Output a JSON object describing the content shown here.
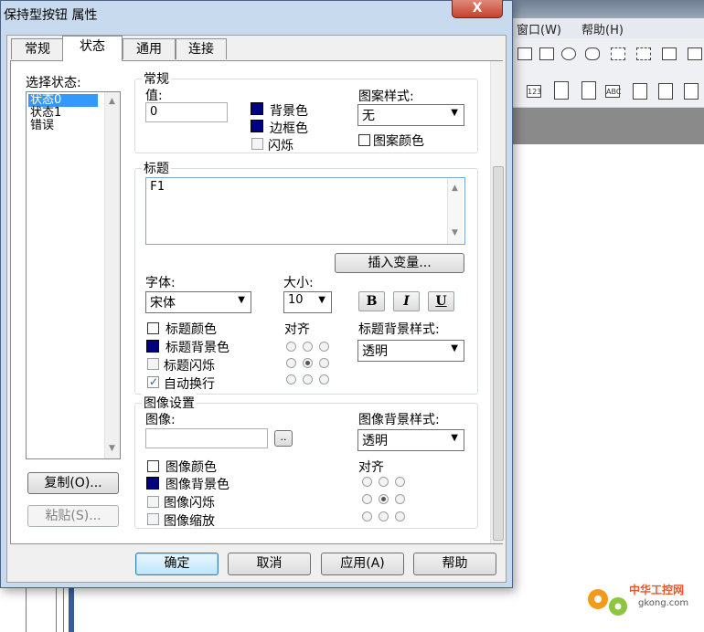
{
  "background_app": {
    "menu": [
      "窗口(W)",
      "帮助(H)"
    ],
    "toolbar_row1_icons": [
      "grid-icon",
      "dots-icon",
      "rotate-icon",
      "undo-shape-icon",
      "align-icon",
      "align2-icon",
      "arrange-icon",
      "more-icon"
    ],
    "toolbar_row2_icons": [
      "123-icon",
      "panel-icon",
      "list-icon",
      "abc-icon",
      "window-icon",
      "import-icon",
      "export-icon"
    ],
    "toolbar_row2_text": [
      "123",
      "ABC"
    ],
    "watermark_text": "中华工控网",
    "watermark_url": "gkong.com"
  },
  "dialog": {
    "title": "保持型按钮 属性",
    "close_label": "X",
    "tabs": [
      "常规",
      "状态",
      "通用",
      "连接"
    ],
    "state_panel": {
      "label": "选择状态:",
      "items": [
        "状态0",
        "状态1",
        "错误"
      ],
      "selected_index": 0,
      "copy_button": "复制(O)...",
      "paste_button": "粘贴(S)..."
    },
    "general": {
      "group_label": "常规",
      "value_label": "值:",
      "value": "0",
      "bg_color_label": "背景色",
      "border_color_label": "边框色",
      "blink_label": "闪烁",
      "pattern_style_label": "图案样式:",
      "pattern_style_value": "无",
      "pattern_color_label": "图案颜色"
    },
    "caption": {
      "group_label": "标题",
      "text": "F1",
      "insert_var_button": "插入变量...",
      "font_label": "字体:",
      "font_value": "宋体",
      "size_label": "大小:",
      "size_value": "10",
      "bold": "B",
      "italic": "I",
      "underline": "U",
      "title_color_label": "标题颜色",
      "title_bg_color_label": "标题背景色",
      "title_blink_label": "标题闪烁",
      "auto_wrap_label": "自动换行",
      "auto_wrap_checked": true,
      "align_label": "对齐",
      "title_bg_style_label": "标题背景样式:",
      "title_bg_style_value": "透明"
    },
    "image": {
      "group_label": "图像设置",
      "image_label": "图像:",
      "image_value": "",
      "browse_label": "..",
      "image_bg_style_label": "图像背景样式:",
      "image_bg_style_value": "透明",
      "image_color_label": "图像颜色",
      "image_bg_color_label": "图像背景色",
      "image_blink_label": "图像闪烁",
      "image_scale_label": "图像缩放",
      "align_label": "对齐"
    },
    "footer": {
      "ok": "确定",
      "cancel": "取消",
      "apply": "应用(A)",
      "help": "帮助"
    },
    "colors": {
      "swatch_navy": "#000080",
      "selection": "#3399ff",
      "title_bar": "#c8dbee"
    }
  }
}
